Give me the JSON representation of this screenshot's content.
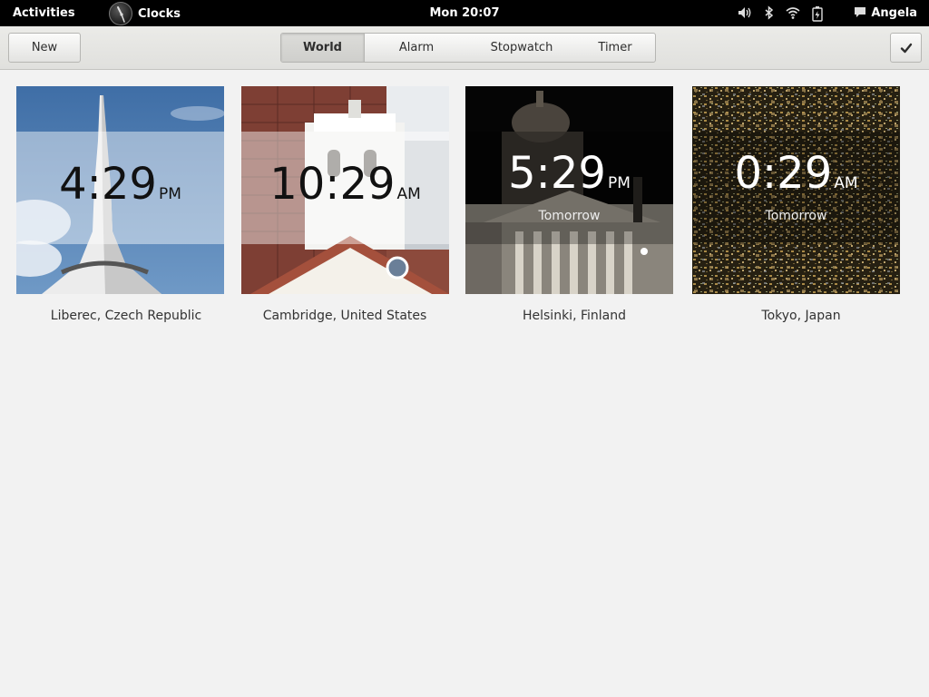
{
  "topbar": {
    "activities": "Activities",
    "app_name": "Clocks",
    "clock": "Mon 20:07",
    "user": "Angela",
    "icons": [
      "volume-icon",
      "bluetooth-icon",
      "wifi-icon",
      "battery-icon",
      "chat-icon"
    ]
  },
  "header": {
    "new_label": "New",
    "done_icon": "checkmark-icon",
    "tabs": [
      {
        "label": "World",
        "selected": true
      },
      {
        "label": "Alarm",
        "selected": false
      },
      {
        "label": "Stopwatch",
        "selected": false
      },
      {
        "label": "Timer",
        "selected": false
      }
    ]
  },
  "clocks": [
    {
      "time": "4:29",
      "ampm": "PM",
      "day": "",
      "city": "Liberec, Czech Republic",
      "theme": "light"
    },
    {
      "time": "10:29",
      "ampm": "AM",
      "day": "",
      "city": "Cambridge, United States",
      "theme": "light"
    },
    {
      "time": "5:29",
      "ampm": "PM",
      "day": "Tomorrow",
      "city": "Helsinki, Finland",
      "theme": "dark"
    },
    {
      "time": "0:29",
      "ampm": "AM",
      "day": "Tomorrow",
      "city": "Tokyo, Japan",
      "theme": "dark"
    }
  ],
  "colors": {
    "topbar": "#000000",
    "header": "#e5e5e2",
    "background": "#f2f2f2"
  }
}
